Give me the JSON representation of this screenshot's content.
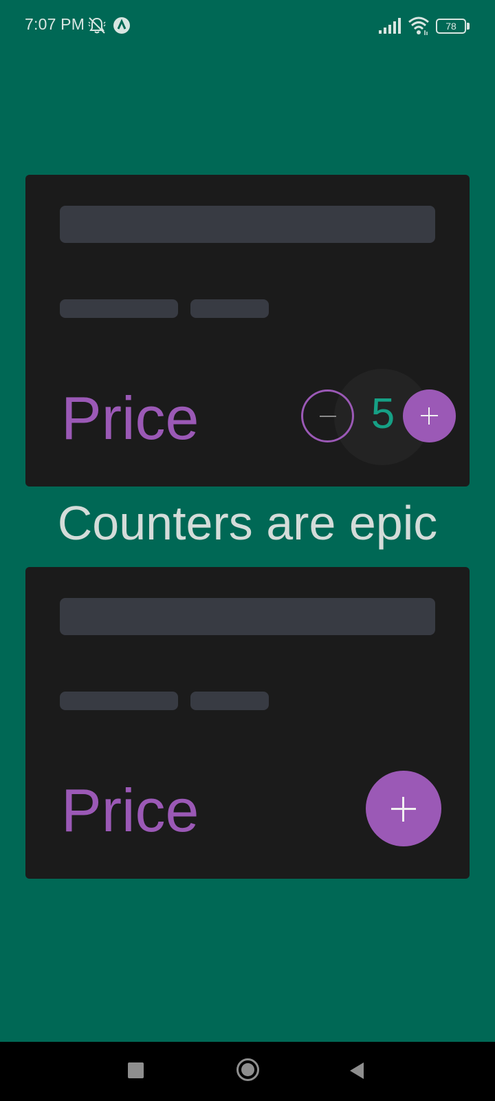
{
  "status_bar": {
    "time": "7:07 PM",
    "icons": [
      "bell-muted-icon",
      "app-notification-icon",
      "signal-icon",
      "wifi-icon",
      "battery-icon"
    ],
    "battery_level": "78"
  },
  "cards": [
    {
      "price_label": "Price",
      "counter": {
        "value": "5",
        "decrement_icon": "minus-icon",
        "increment_icon": "plus-icon"
      }
    },
    {
      "price_label": "Price",
      "add_icon": "plus-icon"
    }
  ],
  "heading": "Counters are epic",
  "colors": {
    "background": "#006855",
    "card": "#1b1b1b",
    "skeleton": "#383b43",
    "accent_purple": "#9b59b6",
    "counter_teal": "#16a085",
    "heading_text": "#d4dcd9"
  },
  "nav_bar": {
    "icons": [
      "recents-square-icon",
      "home-circle-icon",
      "back-triangle-icon"
    ]
  }
}
